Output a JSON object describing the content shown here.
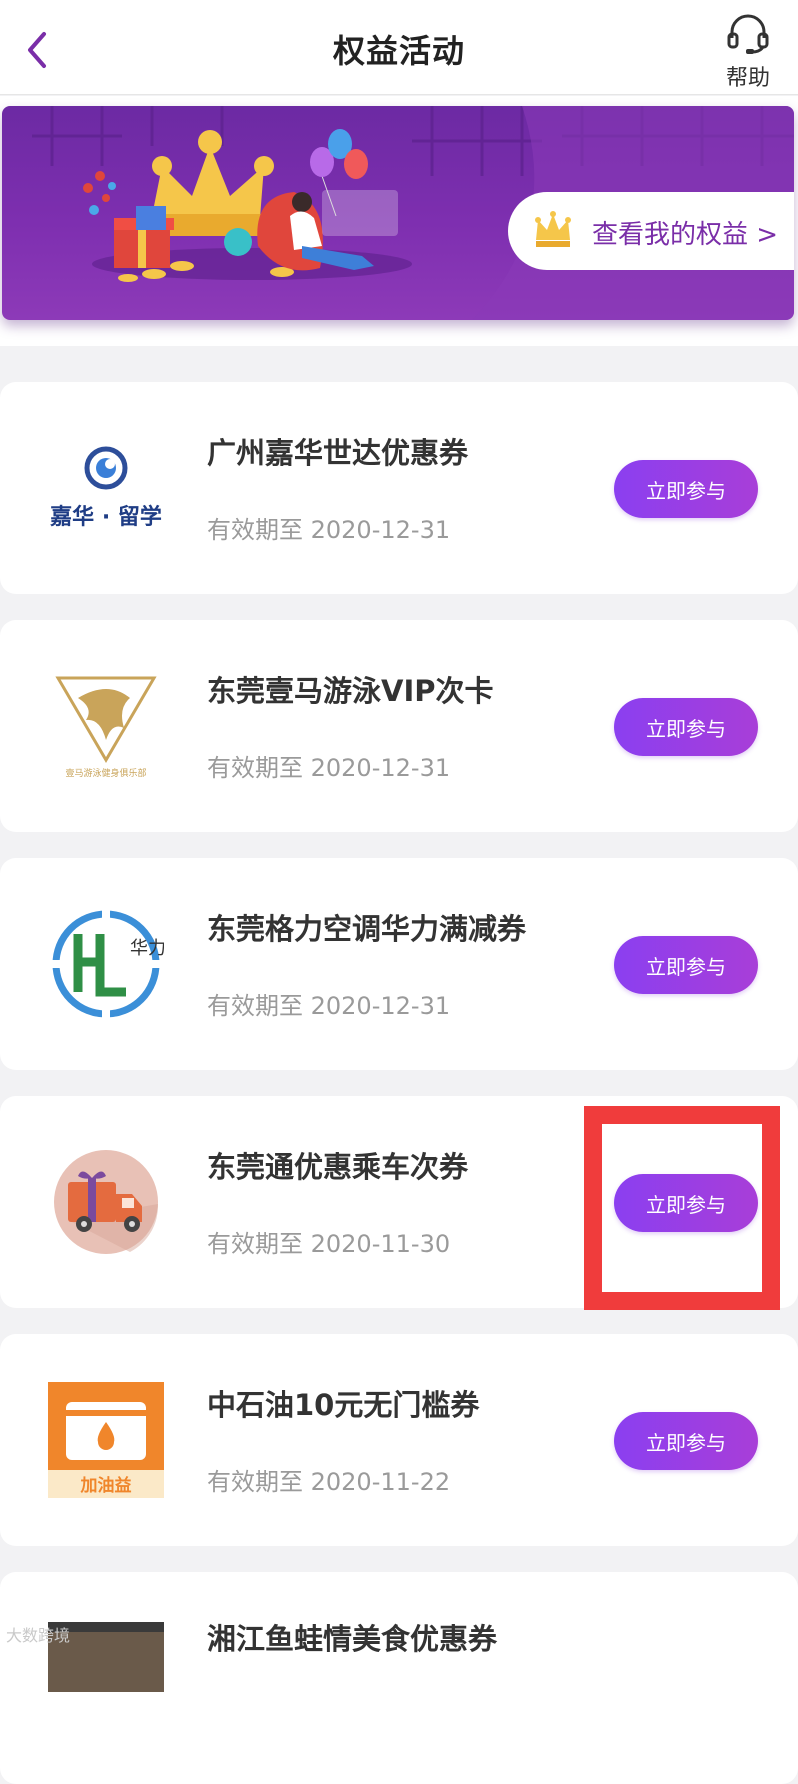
{
  "header": {
    "title": "权益活动",
    "help_label": "帮助"
  },
  "banner": {
    "button_label": "查看我的权益 >"
  },
  "activities": [
    {
      "name": "广州嘉华世达优惠券",
      "expiry": "有效期至 2020-12-31",
      "button": "立即参与",
      "logo_text": "嘉华 · 留学"
    },
    {
      "name": "东莞壹马游泳VIP次卡",
      "expiry": "有效期至 2020-12-31",
      "button": "立即参与",
      "logo_text": "壹马游泳健身俱乐部"
    },
    {
      "name": "东莞格力空调华力满减券",
      "expiry": "有效期至 2020-12-31",
      "button": "立即参与",
      "logo_text": "华力"
    },
    {
      "name": "东莞通优惠乘车次券",
      "expiry": "有效期至 2020-11-30",
      "button": "立即参与"
    },
    {
      "name": "中石油10元无门槛券",
      "expiry": "有效期至 2020-11-22",
      "button": "立即参与",
      "logo_text": "加油益"
    },
    {
      "name": "湘江鱼蛙情美食优惠券"
    }
  ],
  "watermark": "大数跨境",
  "colors": {
    "accent": "#8b3ff0",
    "banner": "#7e2fb0",
    "highlight": "#f03c3c"
  }
}
